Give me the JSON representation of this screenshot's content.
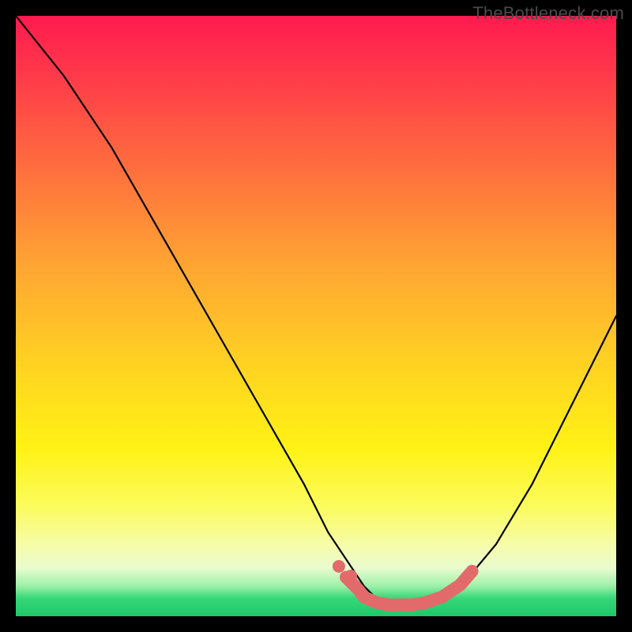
{
  "watermark": {
    "text": "TheBottleneck.com"
  },
  "chart_data": {
    "type": "line",
    "title": "",
    "xlabel": "",
    "ylabel": "",
    "xlim": [
      0,
      100
    ],
    "ylim": [
      0,
      100
    ],
    "grid": false,
    "legend": false,
    "series": [
      {
        "name": "bottleneck-curve",
        "x": [
          0,
          8,
          16,
          24,
          32,
          40,
          48,
          52,
          56,
          58,
          60,
          62,
          65,
          68,
          72,
          75,
          80,
          86,
          92,
          100
        ],
        "values": [
          100,
          90,
          78,
          64,
          50,
          36,
          22,
          14,
          8,
          5,
          3,
          2,
          2,
          2,
          3,
          6,
          12,
          22,
          34,
          50
        ]
      }
    ],
    "highlight_segment": {
      "name": "optimal-zone-marker",
      "color": "#e26a6a",
      "x": [
        55,
        57,
        58,
        60,
        62,
        64,
        66,
        68,
        71,
        74,
        76
      ],
      "values": [
        6.5,
        4.5,
        3.2,
        2.3,
        1.9,
        1.9,
        1.9,
        2.2,
        3.2,
        5.2,
        7.5
      ]
    },
    "background_gradient": {
      "orientation": "vertical",
      "stops": [
        {
          "pos": 0.0,
          "color": "#ff1a4e"
        },
        {
          "pos": 0.25,
          "color": "#ff6d3e"
        },
        {
          "pos": 0.55,
          "color": "#ffd222"
        },
        {
          "pos": 0.82,
          "color": "#fbfc60"
        },
        {
          "pos": 0.95,
          "color": "#9cf0a8"
        },
        {
          "pos": 1.0,
          "color": "#1fc86a"
        }
      ]
    }
  }
}
